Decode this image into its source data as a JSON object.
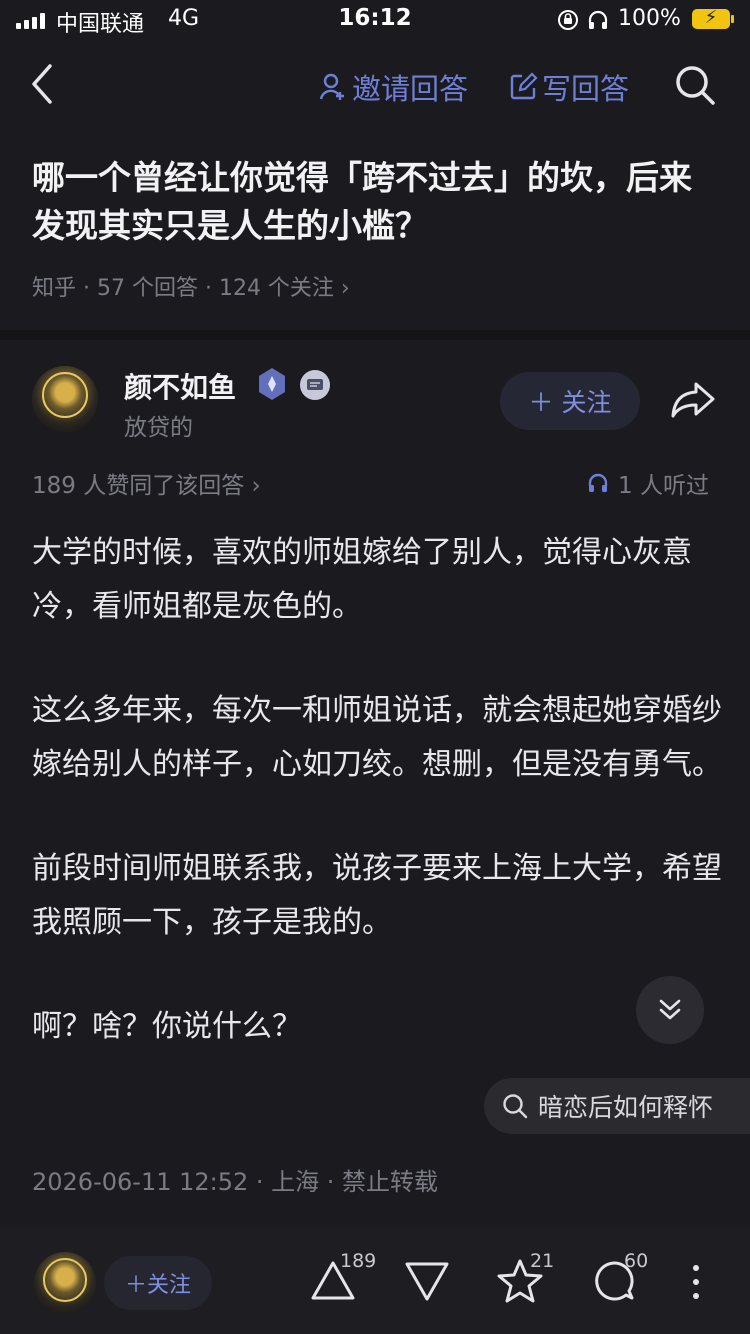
{
  "status_bar": {
    "carrier": "中国联通",
    "network": "4G",
    "time": "16:12",
    "battery": "100%"
  },
  "nav": {
    "invite_label": "邀请回答",
    "write_label": "写回答"
  },
  "question": {
    "title": "哪一个曾经让你觉得「跨不过去」的坎，后来发现其实只是人生的小槛？",
    "meta": "知乎 · 57 个回答 · 124 个关注 ›"
  },
  "author": {
    "name": "颜不如鱼",
    "subtitle": "放贷的",
    "follow_label": "＋ 关注"
  },
  "answer": {
    "likes_text": "189 人赞同了该回答 ›",
    "listened_text": "1 人听过",
    "paragraphs": [
      "大学的时候，喜欢的师姐嫁给了别人，觉得心灰意冷，看师姐都是灰色的。",
      "这么多年来，每次一和师姐说话，就会想起她穿婚纱嫁给别人的样子，心如刀绞。想删，但是没有勇气。",
      "前段时间师姐联系我，说孩子要来上海上大学，希望我照顾一下，孩子是我的。",
      "啊？啥？你说什么？"
    ],
    "footer": "2026-06-11 12:52 · 上海 · 禁止转载"
  },
  "related_search": "暗恋后如何释怀",
  "bottom_bar": {
    "follow_label": "＋关注",
    "upvote_count": "189",
    "favorite_count": "21",
    "comment_count": "60"
  },
  "colors": {
    "background": "#1b1b1f",
    "accent": "#6e7fd8"
  }
}
